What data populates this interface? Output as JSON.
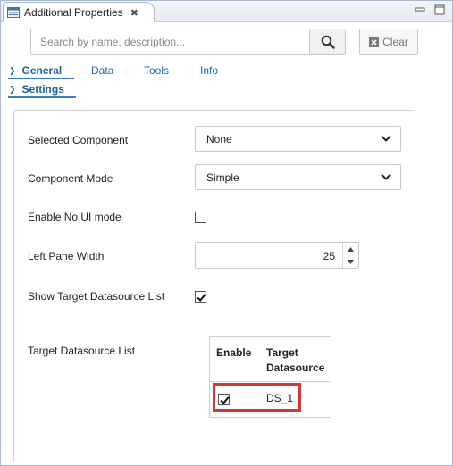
{
  "view": {
    "title": "Additional Properties",
    "close_glyph": "✖"
  },
  "search": {
    "placeholder": "Search by name, description...",
    "value": "",
    "clear_label": "Clear"
  },
  "section_tabs": [
    {
      "label": "General",
      "active": true
    },
    {
      "label": "Data",
      "active": false
    },
    {
      "label": "Tools",
      "active": false
    },
    {
      "label": "Info",
      "active": false
    }
  ],
  "subsection": {
    "label": "Settings",
    "active": true
  },
  "properties": {
    "selected_component": {
      "label": "Selected Component",
      "value": "None"
    },
    "component_mode": {
      "label": "Component Mode",
      "value": "Simple"
    },
    "enable_no_ui": {
      "label": "Enable No UI mode",
      "checked": false
    },
    "left_pane_width": {
      "label": "Left Pane Width",
      "value": "25"
    },
    "show_target_ds": {
      "label": "Show Target Datasource List",
      "checked": true
    },
    "target_ds_list": {
      "label": "Target Datasource List"
    }
  },
  "datasource_table": {
    "headers": [
      "Enable",
      "Target",
      "Datasource"
    ],
    "rows": [
      {
        "enabled": true,
        "name": "DS_1"
      }
    ]
  },
  "colors": {
    "accent": "#1f5f9e",
    "highlight": "#d23a3a"
  }
}
